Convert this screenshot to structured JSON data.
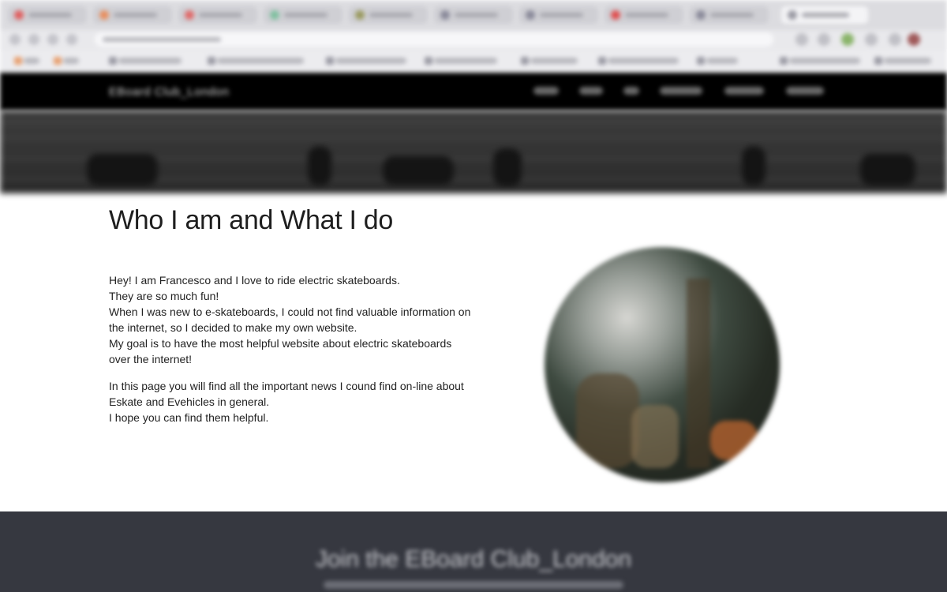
{
  "site": {
    "brand": "EBoard Club_London",
    "nav_items": [
      "",
      "",
      "",
      "",
      "",
      ""
    ]
  },
  "main": {
    "title": "Who I am and What I do",
    "intro_lines": [
      "Hey! I am Francesco and I love to ride electric skateboards.",
      "They are so much fun!",
      "When I was new to e-skateboards, I could not find valuable information on",
      "the internet, so I decided to make my own website.",
      "My goal is to have the most helpful website about electric skateboards",
      "over the internet!"
    ],
    "news_lines": [
      "In this page you will find all the important news I cound find on-line about",
      "Eskate and Evehicles in general.",
      "I hope you can find them helpful."
    ]
  },
  "footer": {
    "title": "Join the EBoard Club_London"
  },
  "colors": {
    "nav_bg": "#000000",
    "footer_bg": "#363840",
    "text": "#222222"
  }
}
